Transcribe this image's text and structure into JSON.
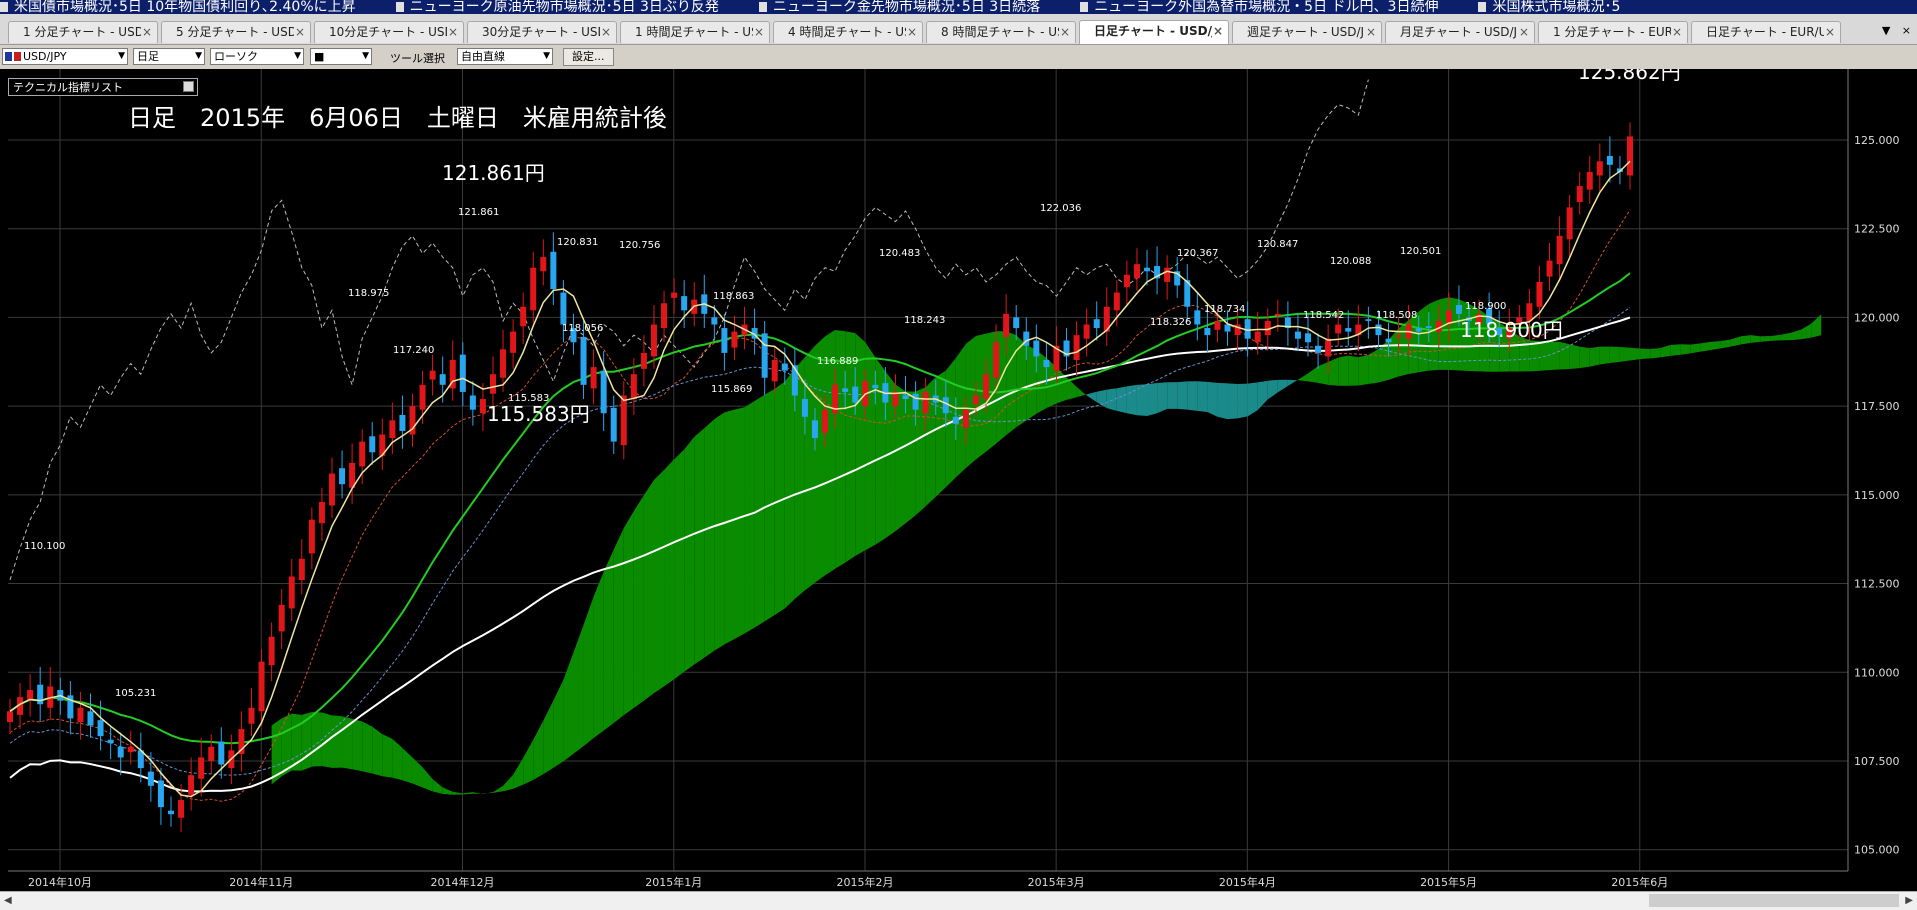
{
  "ticker": [
    "米国債市場概況･5日 10年物国債利回り､2.40%に上昇",
    "ニューヨーク原油先物市場概況･5日 3日ぶり反発",
    "ニューヨーク金先物市場概況･5日 3日続落",
    "ニューヨーク外国為替市場概況・5日 ドル円、3日続伸",
    "米国株式市場概況･5"
  ],
  "tabs": [
    {
      "label": "1 分足チャート - USD/",
      "active": false
    },
    {
      "label": "5 分足チャート - USD/",
      "active": false
    },
    {
      "label": "10分足チャート - USD,",
      "active": false
    },
    {
      "label": "30分足チャート - USD,",
      "active": false
    },
    {
      "label": "1 時間足チャート - US",
      "active": false
    },
    {
      "label": "4 時間足チャート - US",
      "active": false
    },
    {
      "label": "8 時間足チャート - US",
      "active": false
    },
    {
      "label": "日足チャート - USD/J",
      "active": true
    },
    {
      "label": "週足チャート - USD/JP",
      "active": false
    },
    {
      "label": "月足チャート - USD/JP",
      "active": false
    },
    {
      "label": "1 分足チャート - EUR/",
      "active": false
    },
    {
      "label": "日足チャート - EUR/US",
      "active": false
    }
  ],
  "tab_close": "×",
  "tabbar_controls": {
    "menu": "▼",
    "close": "×"
  },
  "toolbar": {
    "symbol": "USD/JPY",
    "timeframe": "日足",
    "chart_type": "ローソク",
    "line_style": "■",
    "tool_label": "ツール選択",
    "tool_value": "自由直線",
    "settings_button": "設定..."
  },
  "indicator_box": {
    "label": "テクニカル指標リスト"
  },
  "chart_title": "日足　2015年　6月06日　土曜日　米雇用統計後",
  "colors": {
    "up": "#e0161a",
    "down": "#28a6f0",
    "kumo_bull": "#0a8c00",
    "kumo_bear": "#1b8a8a",
    "sma_short": "#f0e6a0",
    "sma_mid": "#22cc22",
    "sma_long": "#ffffff",
    "grid": "#3a3a3a"
  },
  "chart_data": {
    "type": "candlestick",
    "symbol": "USD/JPY",
    "timeframe": "daily",
    "x_labels": [
      "2014年10月",
      "2014年11月",
      "2014年12月",
      "2015年1月",
      "2015年2月",
      "2015年3月",
      "2015年4月",
      "2015年5月",
      "2015年6月"
    ],
    "y_ticks": [
      "105.000",
      "107.500",
      "110.000",
      "112.500",
      "115.000",
      "117.500",
      "120.000",
      "122.500",
      "125.000"
    ],
    "ylim": [
      104.4,
      127.0
    ],
    "annotations_large": [
      "125.862円",
      "121.861円",
      "115.583円",
      "118.900円"
    ],
    "annotations_small": [
      "110.100",
      "105.231",
      "118.975",
      "117.240",
      "121.861",
      "115.583",
      "120.831",
      "120.756",
      "118.056",
      "118.863",
      "115.869",
      "116.889",
      "120.483",
      "118.243",
      "122.036",
      "118.326",
      "120.367",
      "118.734",
      "120.847",
      "118.542",
      "120.088",
      "118.508",
      "120.501",
      "118.900"
    ],
    "closes_approx": [
      108.9,
      109.3,
      109.5,
      109.1,
      109.6,
      109.2,
      108.7,
      109.0,
      108.5,
      108.2,
      108.0,
      107.6,
      107.9,
      107.3,
      106.8,
      106.2,
      106.0,
      106.4,
      107.1,
      107.6,
      107.9,
      107.4,
      107.8,
      108.4,
      109.0,
      110.3,
      111.0,
      111.9,
      112.7,
      113.2,
      114.3,
      114.8,
      115.6,
      115.3,
      115.9,
      116.5,
      116.2,
      116.7,
      117.1,
      116.8,
      117.5,
      118.1,
      118.5,
      118.1,
      118.8,
      117.9,
      117.4,
      117.7,
      118.4,
      119.1,
      119.6,
      120.3,
      121.4,
      121.7,
      120.8,
      119.8,
      119.3,
      118.1,
      118.6,
      117.3,
      116.5,
      117.8,
      118.4,
      119.0,
      119.8,
      120.4,
      120.7,
      120.2,
      120.5,
      120.1,
      119.8,
      119.0,
      119.6,
      119.8,
      119.4,
      118.3,
      118.8,
      118.5,
      117.8,
      117.2,
      116.6,
      117.4,
      118.1,
      117.9,
      117.6,
      118.2,
      118.0,
      117.6,
      117.9,
      117.7,
      117.4,
      117.9,
      117.6,
      117.3,
      117.0,
      117.4,
      117.8,
      118.4,
      119.3,
      120.1,
      119.7,
      119.2,
      118.9,
      118.6,
      119.2,
      118.9,
      119.5,
      119.8,
      119.7,
      120.3,
      120.7,
      121.2,
      121.5,
      121.3,
      121.1,
      121.4,
      120.9,
      120.3,
      119.8,
      119.5,
      119.9,
      119.6,
      119.8,
      119.4,
      119.6,
      119.9,
      120.1,
      119.7,
      119.4,
      119.3,
      119.0,
      119.4,
      119.8,
      119.6,
      119.8,
      119.9,
      119.5,
      119.3,
      119.5,
      119.8,
      119.6,
      119.7,
      119.9,
      120.2,
      120.1,
      119.9,
      120.1,
      119.8,
      119.5,
      119.7,
      120.0,
      120.4,
      121.0,
      121.6,
      122.3,
      123.1,
      123.7,
      124.1,
      124.4,
      124.3,
      124.1,
      125.1
    ]
  }
}
